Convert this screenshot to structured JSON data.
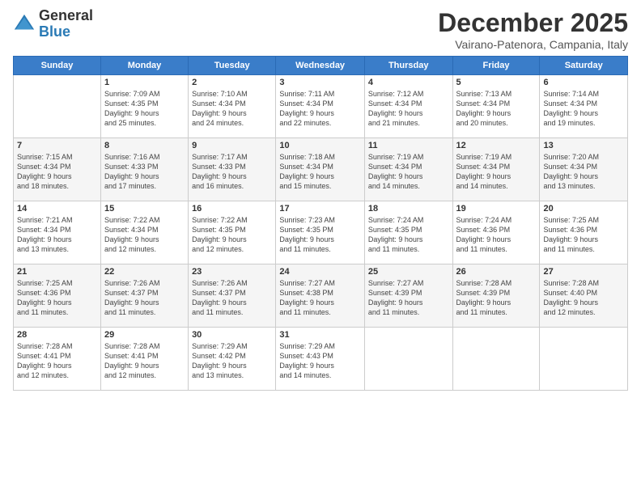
{
  "logo": {
    "general": "General",
    "blue": "Blue"
  },
  "title": "December 2025",
  "location": "Vairano-Patenora, Campania, Italy",
  "days_of_week": [
    "Sunday",
    "Monday",
    "Tuesday",
    "Wednesday",
    "Thursday",
    "Friday",
    "Saturday"
  ],
  "weeks": [
    [
      {
        "day": "",
        "info": ""
      },
      {
        "day": "1",
        "info": "Sunrise: 7:09 AM\nSunset: 4:35 PM\nDaylight: 9 hours\nand 25 minutes."
      },
      {
        "day": "2",
        "info": "Sunrise: 7:10 AM\nSunset: 4:34 PM\nDaylight: 9 hours\nand 24 minutes."
      },
      {
        "day": "3",
        "info": "Sunrise: 7:11 AM\nSunset: 4:34 PM\nDaylight: 9 hours\nand 22 minutes."
      },
      {
        "day": "4",
        "info": "Sunrise: 7:12 AM\nSunset: 4:34 PM\nDaylight: 9 hours\nand 21 minutes."
      },
      {
        "day": "5",
        "info": "Sunrise: 7:13 AM\nSunset: 4:34 PM\nDaylight: 9 hours\nand 20 minutes."
      },
      {
        "day": "6",
        "info": "Sunrise: 7:14 AM\nSunset: 4:34 PM\nDaylight: 9 hours\nand 19 minutes."
      }
    ],
    [
      {
        "day": "7",
        "info": "Sunrise: 7:15 AM\nSunset: 4:34 PM\nDaylight: 9 hours\nand 18 minutes."
      },
      {
        "day": "8",
        "info": "Sunrise: 7:16 AM\nSunset: 4:33 PM\nDaylight: 9 hours\nand 17 minutes."
      },
      {
        "day": "9",
        "info": "Sunrise: 7:17 AM\nSunset: 4:33 PM\nDaylight: 9 hours\nand 16 minutes."
      },
      {
        "day": "10",
        "info": "Sunrise: 7:18 AM\nSunset: 4:34 PM\nDaylight: 9 hours\nand 15 minutes."
      },
      {
        "day": "11",
        "info": "Sunrise: 7:19 AM\nSunset: 4:34 PM\nDaylight: 9 hours\nand 14 minutes."
      },
      {
        "day": "12",
        "info": "Sunrise: 7:19 AM\nSunset: 4:34 PM\nDaylight: 9 hours\nand 14 minutes."
      },
      {
        "day": "13",
        "info": "Sunrise: 7:20 AM\nSunset: 4:34 PM\nDaylight: 9 hours\nand 13 minutes."
      }
    ],
    [
      {
        "day": "14",
        "info": "Sunrise: 7:21 AM\nSunset: 4:34 PM\nDaylight: 9 hours\nand 13 minutes."
      },
      {
        "day": "15",
        "info": "Sunrise: 7:22 AM\nSunset: 4:34 PM\nDaylight: 9 hours\nand 12 minutes."
      },
      {
        "day": "16",
        "info": "Sunrise: 7:22 AM\nSunset: 4:35 PM\nDaylight: 9 hours\nand 12 minutes."
      },
      {
        "day": "17",
        "info": "Sunrise: 7:23 AM\nSunset: 4:35 PM\nDaylight: 9 hours\nand 11 minutes."
      },
      {
        "day": "18",
        "info": "Sunrise: 7:24 AM\nSunset: 4:35 PM\nDaylight: 9 hours\nand 11 minutes."
      },
      {
        "day": "19",
        "info": "Sunrise: 7:24 AM\nSunset: 4:36 PM\nDaylight: 9 hours\nand 11 minutes."
      },
      {
        "day": "20",
        "info": "Sunrise: 7:25 AM\nSunset: 4:36 PM\nDaylight: 9 hours\nand 11 minutes."
      }
    ],
    [
      {
        "day": "21",
        "info": "Sunrise: 7:25 AM\nSunset: 4:36 PM\nDaylight: 9 hours\nand 11 minutes."
      },
      {
        "day": "22",
        "info": "Sunrise: 7:26 AM\nSunset: 4:37 PM\nDaylight: 9 hours\nand 11 minutes."
      },
      {
        "day": "23",
        "info": "Sunrise: 7:26 AM\nSunset: 4:37 PM\nDaylight: 9 hours\nand 11 minutes."
      },
      {
        "day": "24",
        "info": "Sunrise: 7:27 AM\nSunset: 4:38 PM\nDaylight: 9 hours\nand 11 minutes."
      },
      {
        "day": "25",
        "info": "Sunrise: 7:27 AM\nSunset: 4:39 PM\nDaylight: 9 hours\nand 11 minutes."
      },
      {
        "day": "26",
        "info": "Sunrise: 7:28 AM\nSunset: 4:39 PM\nDaylight: 9 hours\nand 11 minutes."
      },
      {
        "day": "27",
        "info": "Sunrise: 7:28 AM\nSunset: 4:40 PM\nDaylight: 9 hours\nand 12 minutes."
      }
    ],
    [
      {
        "day": "28",
        "info": "Sunrise: 7:28 AM\nSunset: 4:41 PM\nDaylight: 9 hours\nand 12 minutes."
      },
      {
        "day": "29",
        "info": "Sunrise: 7:28 AM\nSunset: 4:41 PM\nDaylight: 9 hours\nand 12 minutes."
      },
      {
        "day": "30",
        "info": "Sunrise: 7:29 AM\nSunset: 4:42 PM\nDaylight: 9 hours\nand 13 minutes."
      },
      {
        "day": "31",
        "info": "Sunrise: 7:29 AM\nSunset: 4:43 PM\nDaylight: 9 hours\nand 14 minutes."
      },
      {
        "day": "",
        "info": ""
      },
      {
        "day": "",
        "info": ""
      },
      {
        "day": "",
        "info": ""
      }
    ]
  ]
}
